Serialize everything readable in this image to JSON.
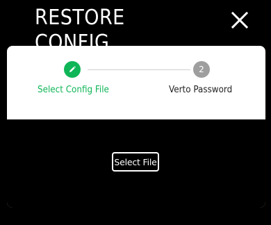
{
  "dialog": {
    "title": "RESTORE CONFIG",
    "close_icon": "close-icon"
  },
  "stepper": {
    "steps": [
      {
        "label": "Select Config File",
        "status": "active",
        "icon": "pencil-icon"
      },
      {
        "label": "Verto Password",
        "status": "pending",
        "number": "2"
      }
    ]
  },
  "upload": {
    "button_label": "Select File"
  },
  "colors": {
    "accent": "#0fb557",
    "pending": "#9e9e9e",
    "background": "#000000",
    "card": "#ffffff"
  }
}
